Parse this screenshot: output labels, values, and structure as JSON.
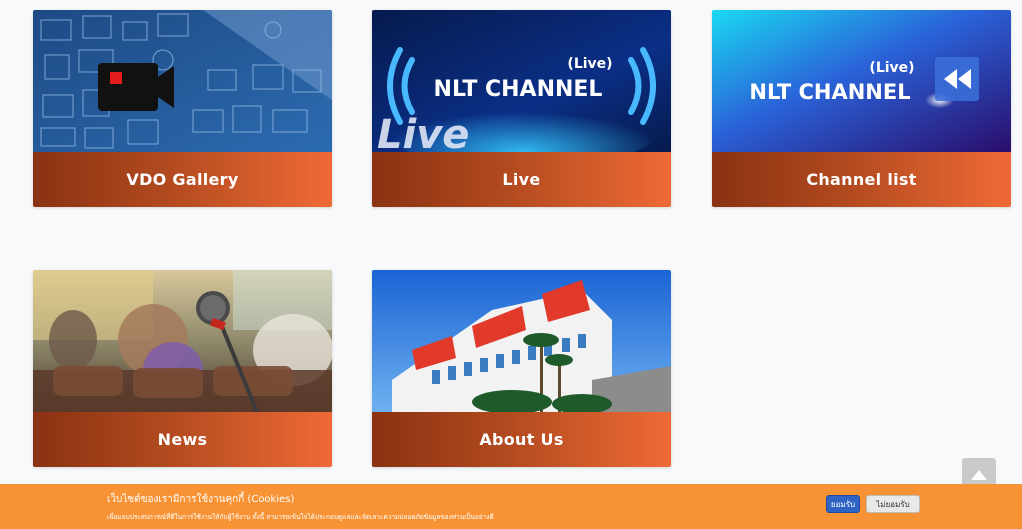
{
  "cards": [
    {
      "label": "VDO Gallery"
    },
    {
      "label": "Live",
      "thumb_title": "NLT CHANNEL",
      "thumb_tag": "(Live)",
      "thumb_overlay": "Live"
    },
    {
      "label": "Channel list",
      "thumb_title": "NLT CHANNEL",
      "thumb_tag": "(Live)"
    },
    {
      "label": "News"
    },
    {
      "label": "About Us"
    }
  ],
  "cookie": {
    "title": "เว็บไซต์ของเรามีการใช้งานคุกกี้ (Cookies)",
    "description": "เพื่อมอบประสบการณ์ที่ดีในการใช้งานให้กับผู้ใช้งาน ทั้งนี้ สามารถเข้นใจได้ประกอบดูแลและจัดเลาะความปลอดภัยข้อมูลของท่านเป็นอย่างดี",
    "accept_label": "ยอมรับ",
    "decline_label": "ไม่ยอมรับ"
  },
  "colors": {
    "label_bar_start": "#8a3212",
    "label_bar_end": "#ef6a35",
    "cookie_bar": "#f79335",
    "accept_button": "#2f64c4"
  },
  "icons": {
    "scroll_top": "chevron-up-icon",
    "camera": "video-camera-icon",
    "rewind": "rewind-icon"
  }
}
